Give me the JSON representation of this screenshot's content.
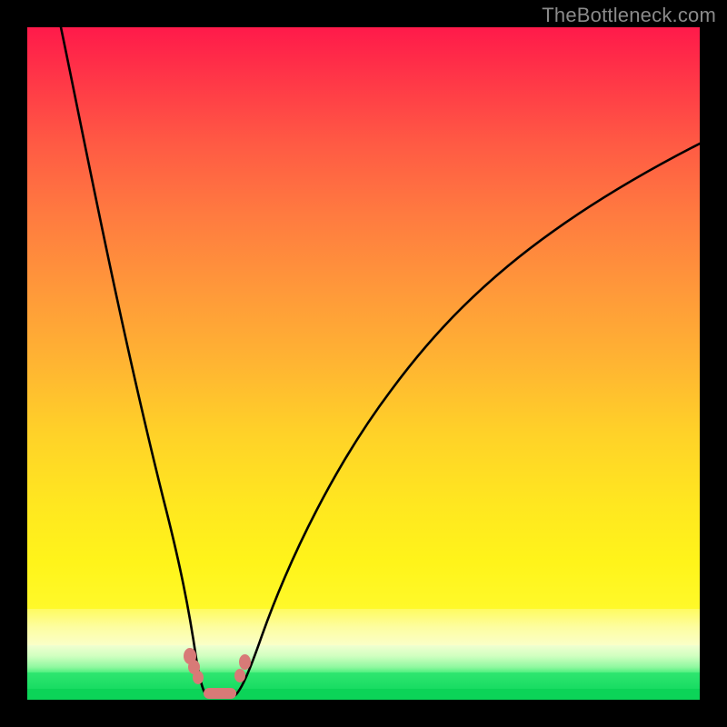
{
  "watermark": "TheBottleneck.com",
  "chart_data": {
    "type": "line",
    "title": "",
    "xlabel": "",
    "ylabel": "",
    "xlim": [
      0,
      100
    ],
    "ylim": [
      0,
      100
    ],
    "grid": false,
    "legend": false,
    "background_gradient": {
      "stops": [
        {
          "pos": 0.0,
          "color": "#ff1a4a"
        },
        {
          "pos": 0.5,
          "color": "#ff983a"
        },
        {
          "pos": 0.86,
          "color": "#fff41a"
        },
        {
          "pos": 0.92,
          "color": "#faffc8"
        },
        {
          "pos": 0.96,
          "color": "#30e670"
        },
        {
          "pos": 1.0,
          "color": "#0cd458"
        }
      ]
    },
    "series": [
      {
        "name": "left-branch",
        "x": [
          5,
          8,
          11,
          14,
          17,
          19,
          21,
          22.5,
          24,
          25,
          25.5,
          26
        ],
        "y": [
          100,
          86,
          72,
          58,
          44,
          32,
          21,
          13,
          7,
          3,
          1.5,
          0.5
        ]
      },
      {
        "name": "valley-floor",
        "x": [
          26,
          27,
          28,
          29,
          30,
          31
        ],
        "y": [
          0.5,
          0.2,
          0.2,
          0.2,
          0.3,
          0.6
        ]
      },
      {
        "name": "right-branch",
        "x": [
          31,
          33,
          36,
          40,
          45,
          52,
          60,
          70,
          80,
          90,
          100
        ],
        "y": [
          0.6,
          3,
          9,
          18,
          29,
          42,
          54,
          65,
          73,
          79,
          83
        ]
      }
    ],
    "markers": [
      {
        "name": "left-cluster-upper",
        "x": 24.0,
        "y": 6.5
      },
      {
        "name": "left-cluster-mid",
        "x": 24.6,
        "y": 4.8
      },
      {
        "name": "left-cluster-lower",
        "x": 25.2,
        "y": 3.2
      },
      {
        "name": "right-cluster-upper",
        "x": 31.8,
        "y": 6.0
      },
      {
        "name": "right-cluster-lower",
        "x": 31.2,
        "y": 4.0
      },
      {
        "name": "valley-bar",
        "x": 28.0,
        "y": 0.6
      }
    ]
  }
}
